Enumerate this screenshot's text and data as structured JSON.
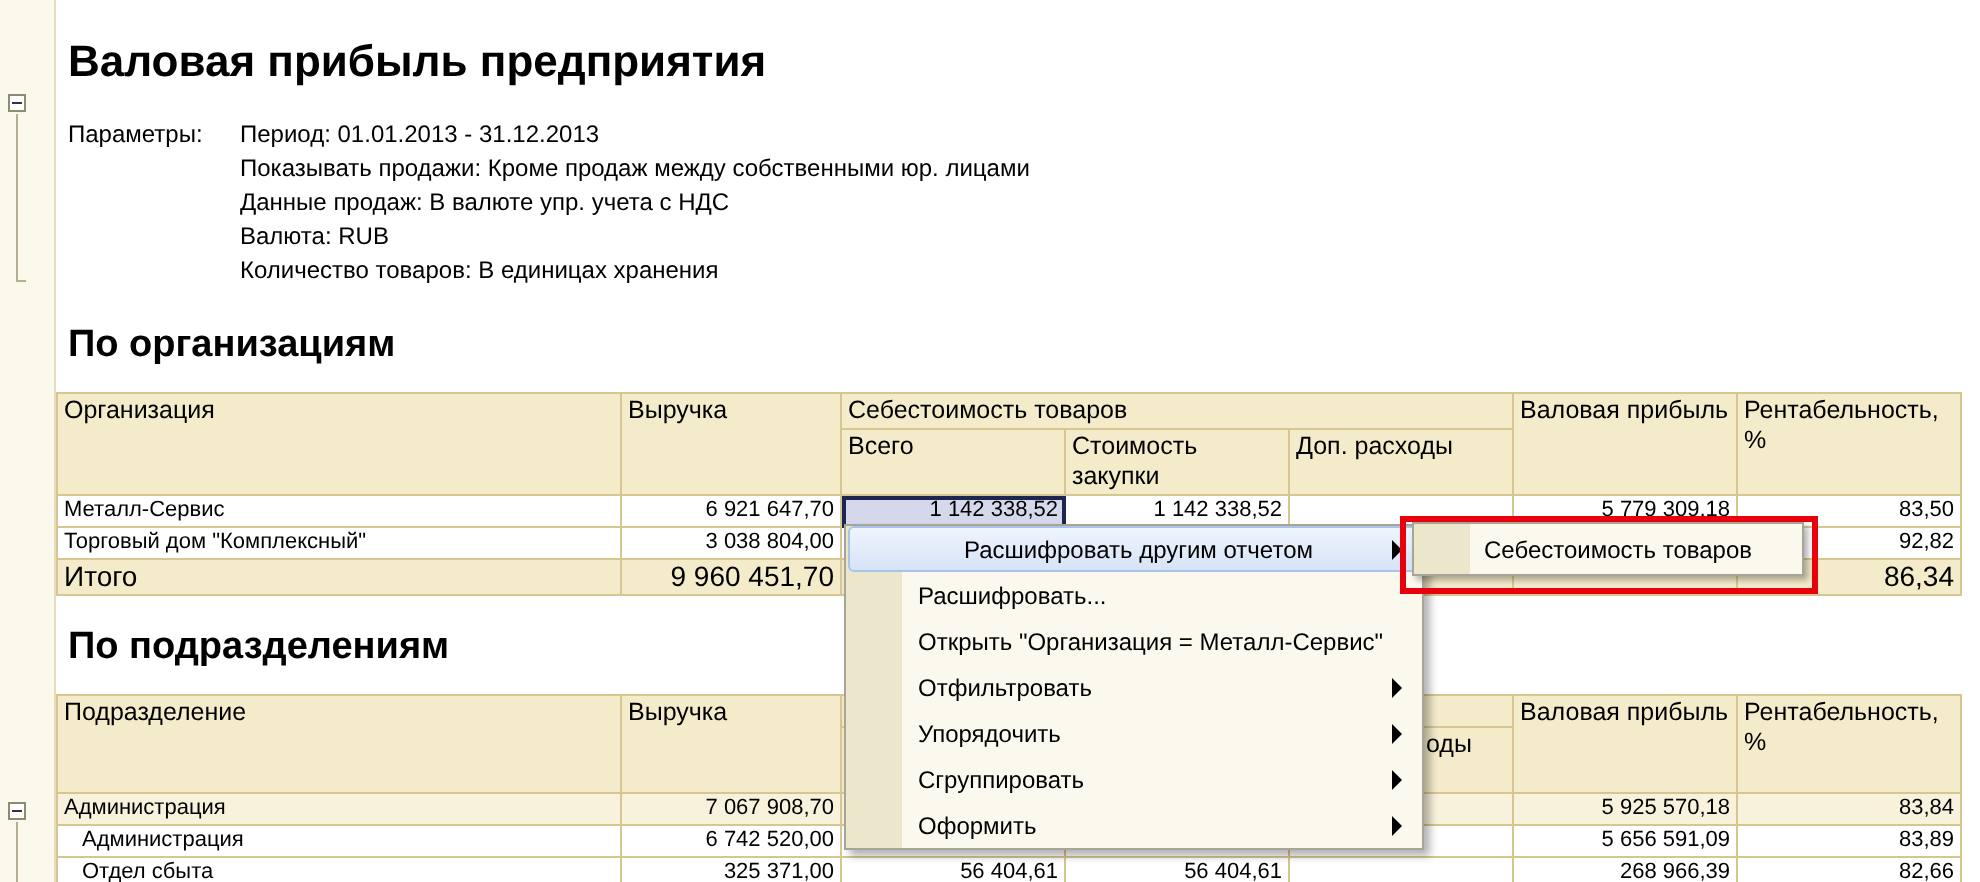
{
  "report": {
    "title": "Валовая прибыль предприятия",
    "parameters_label": "Параметры:",
    "parameters": [
      "Период: 01.01.2013 - 31.12.2013",
      "Показывать продажи: Кроме продаж между собственными юр. лицами",
      "Данные продаж: В валюте упр. учета с НДС",
      "Валюта: RUB",
      "Количество товаров: В единицах хранения"
    ]
  },
  "sections": [
    {
      "heading": "По организациям",
      "column_group": {
        "label": "Себестоимость товаров"
      },
      "columns": [
        {
          "label": "Организация"
        },
        {
          "label": "Выручка"
        },
        {
          "label": "Всего"
        },
        {
          "label": "Стоимость закупки"
        },
        {
          "label": "Доп. расходы"
        },
        {
          "label": "Валовая прибыль"
        },
        {
          "label": "Рентабельность, %"
        }
      ],
      "rows": [
        {
          "kind": "data",
          "cells": [
            {
              "text": "Металл-Сервис",
              "selected": false
            },
            {
              "text": "6 921 647,70",
              "selected": false
            },
            {
              "text": "1 142 338,52",
              "selected": true
            },
            {
              "text": "1 142 338,52",
              "selected": false
            },
            null,
            {
              "text": "5 779 309,18",
              "selected": false
            },
            {
              "text": "83,50",
              "selected": false
            }
          ]
        },
        {
          "kind": "data",
          "cells": [
            {
              "text": "Торговый дом \"Комплексный\"",
              "selected": false
            },
            {
              "text": "3 038 804,00",
              "selected": false
            },
            null,
            null,
            null,
            null,
            {
              "text": "92,82",
              "selected": false
            }
          ]
        },
        {
          "kind": "total",
          "cells": [
            {
              "text": "Итого",
              "selected": false
            },
            {
              "text": "9 960 451,70",
              "selected": false
            },
            null,
            null,
            null,
            null,
            {
              "text": "86,34",
              "selected": false
            }
          ]
        }
      ]
    },
    {
      "heading": "По подразделениям",
      "columns": [
        {
          "label": "Подразделение"
        },
        {
          "label": "Выручка"
        },
        {},
        {},
        {
          "label": "оды"
        },
        {
          "label": "Валовая прибыль"
        },
        {
          "label": "Рентабельность, %"
        }
      ],
      "rows": [
        {
          "kind": "group",
          "expanded": true,
          "cells": [
            {
              "text": "Администрация",
              "selected": false
            },
            {
              "text": "7 067 908,70",
              "selected": false
            },
            null,
            null,
            null,
            {
              "text": "5 925 570,18",
              "selected": false
            },
            {
              "text": "83,84",
              "selected": false
            }
          ]
        },
        {
          "kind": "child",
          "cells": [
            {
              "text": "Администрация",
              "selected": false
            },
            {
              "text": "6 742 520,00",
              "selected": false
            },
            null,
            null,
            null,
            {
              "text": "5 656 591,09",
              "selected": false
            },
            {
              "text": "83,89",
              "selected": false
            }
          ]
        },
        {
          "kind": "child",
          "cells": [
            {
              "text": "Отдел сбыта",
              "selected": false
            },
            {
              "text": "325 371,00",
              "selected": false
            },
            {
              "text": "56 404,61",
              "selected": false
            },
            {
              "text": "56 404,61",
              "selected": false
            },
            null,
            {
              "text": "268 966,39",
              "selected": false
            },
            {
              "text": "82,66",
              "selected": false
            }
          ]
        }
      ]
    }
  ],
  "context_menu": {
    "items": [
      {
        "label": "Расшифровать другим отчетом",
        "submenu": true,
        "selected": true
      },
      {
        "label": "Расшифровать...",
        "submenu": false,
        "selected": false
      },
      {
        "label": "Открыть \"Организация = Металл-Сервис\"",
        "submenu": false,
        "selected": false
      },
      {
        "label": "Отфильтровать",
        "submenu": true,
        "selected": false
      },
      {
        "label": "Упорядочить",
        "submenu": true,
        "selected": false
      },
      {
        "label": "Сгруппировать",
        "submenu": true,
        "selected": false
      },
      {
        "label": "Оформить",
        "submenu": true,
        "selected": false
      }
    ]
  },
  "submenu": {
    "highlighted": true,
    "items": [
      {
        "label": "Себестоимость товаров"
      }
    ]
  }
}
